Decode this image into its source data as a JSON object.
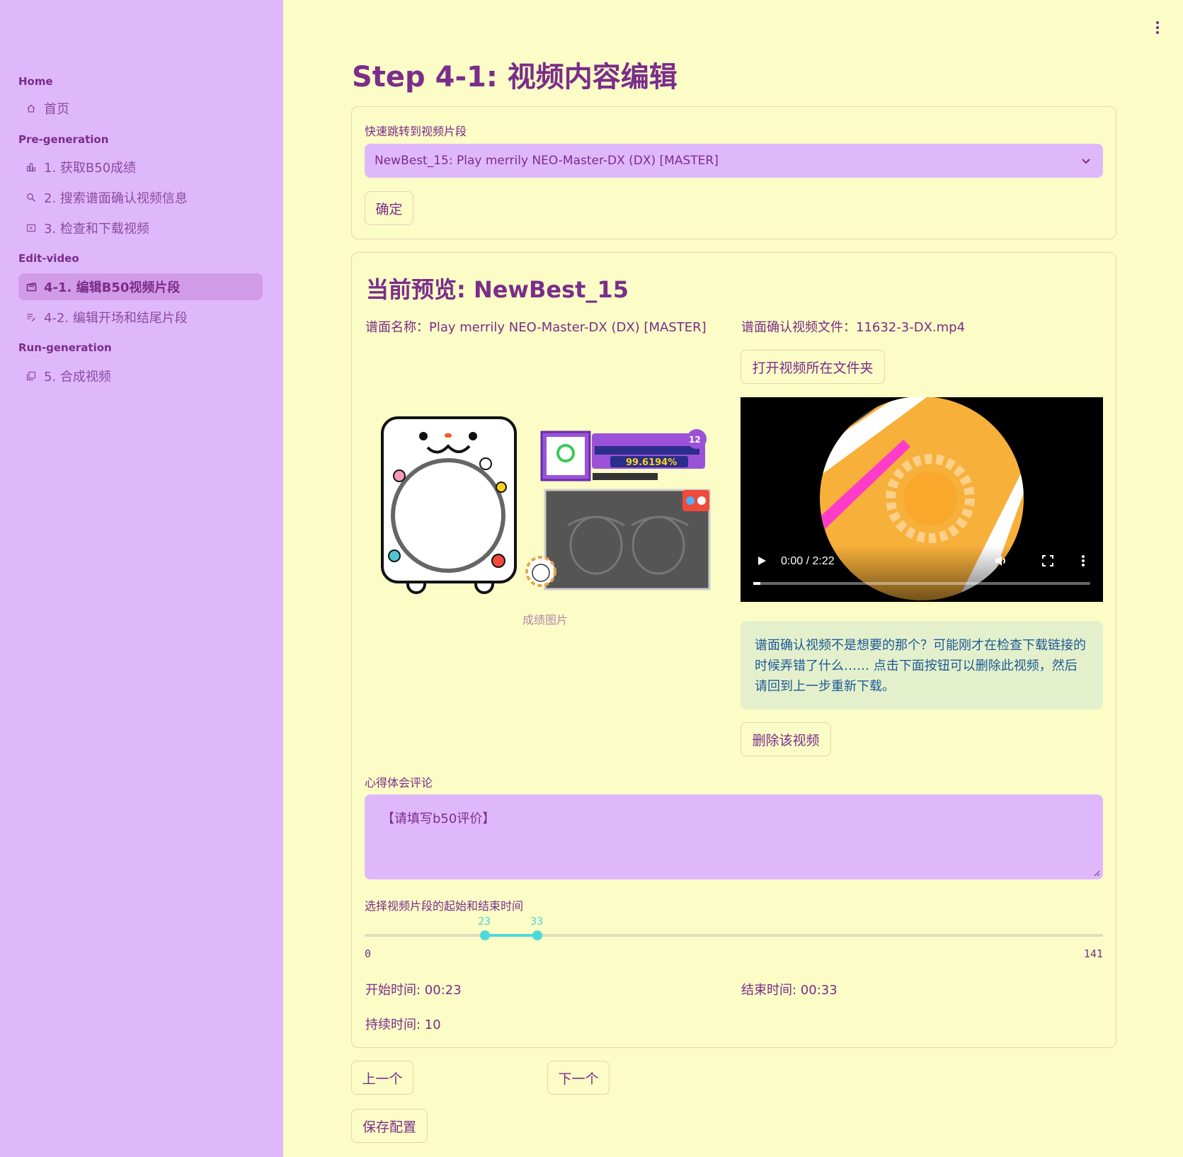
{
  "sidebar": {
    "sections": [
      {
        "title": "Home"
      },
      {
        "title": "Pre-generation"
      },
      {
        "title": "Edit-video"
      },
      {
        "title": "Run-generation"
      }
    ],
    "items": [
      {
        "label": "首页",
        "icon": "home-icon"
      },
      {
        "label": "1. 获取B50成绩",
        "icon": "bar-chart-icon"
      },
      {
        "label": "2. 搜索谱面确认视频信息",
        "icon": "search-icon"
      },
      {
        "label": "3. 检查和下载视频",
        "icon": "video-file-icon"
      },
      {
        "label": "4-1. 编辑B50视频片段",
        "icon": "clapperboard-icon"
      },
      {
        "label": "4-2. 编辑开场和结尾片段",
        "icon": "edit-list-icon"
      },
      {
        "label": "5. 合成视频",
        "icon": "library-icon"
      }
    ]
  },
  "page": {
    "title": "Step 4-1: 视频内容编辑"
  },
  "jump": {
    "label": "快速跳转到视频片段",
    "selected": "NewBest_15: Play merrily NEO-Master-DX (DX) [MASTER]",
    "confirm": "确定"
  },
  "preview": {
    "title": "当前预览: NewBest_15",
    "chart_name": "谱面名称：Play merrily NEO-Master-DX (DX) [MASTER]",
    "video_file": "谱面确认视频文件：11632-3-DX.mp4",
    "open_folder": "打开视频所在文件夹",
    "image_caption": "成绩图片",
    "video_time": "0:00 / 2:22",
    "video_progress": 0.0,
    "alert": "谱面确认视频不是想要的那个？可能刚才在检查下载链接的时候弄错了什么…… 点击下面按钮可以删除此视频，然后请回到上一步重新下载。",
    "delete_video": "删除该视频",
    "comment_label": "心得体会评论",
    "comment_value": "【请填写b50评价】",
    "slider_label": "选择视频片段的起始和结束时间",
    "slider_min": 0,
    "slider_max": 141,
    "slider_start": 23,
    "slider_end": 33,
    "slider_min_text": "0",
    "slider_max_text": "141",
    "slider_start_text": "23",
    "slider_end_text": "33",
    "start_time": "开始时间: 00:23",
    "end_time": "结束时间: 00:33",
    "duration": "持续时间: 10"
  },
  "footer": {
    "prev": "上一个",
    "next": "下一个",
    "save": "保存配置"
  },
  "colors": {
    "background": "#fbfcc6",
    "sidebar": "#dfb8fb",
    "primary_text": "#7a2d8a",
    "slider_accent": "#4dd9d9",
    "alert_bg": "#e4f0cc",
    "alert_text": "#1c5a96"
  }
}
